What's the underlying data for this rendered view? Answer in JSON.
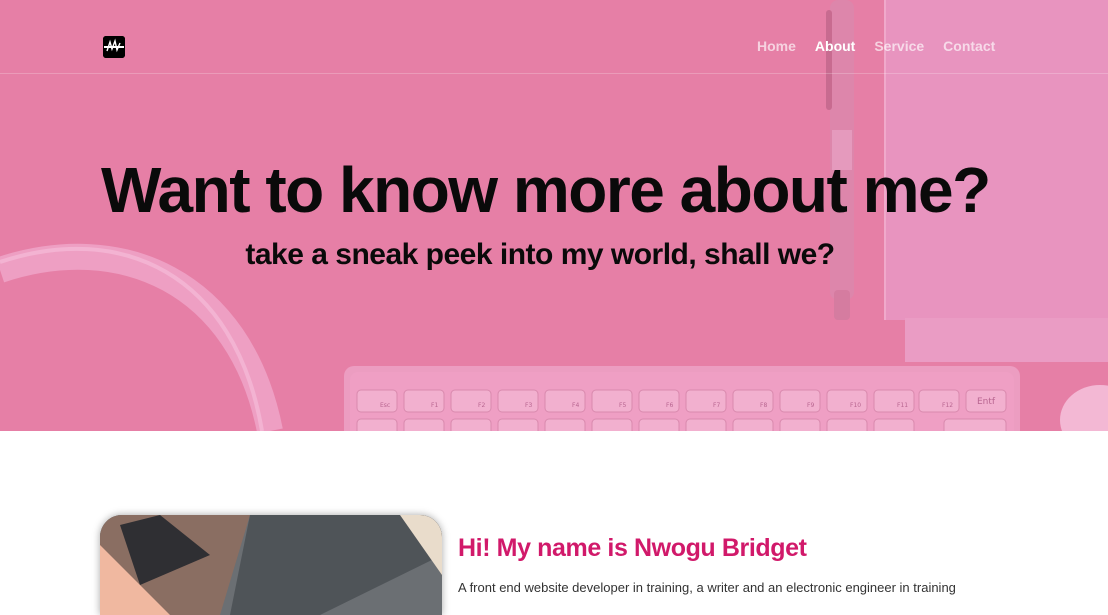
{
  "header": {
    "logo_icon": "nb-logo-icon",
    "nav": [
      {
        "label": "Home",
        "active": false
      },
      {
        "label": "About",
        "active": true
      },
      {
        "label": "Service",
        "active": false
      },
      {
        "label": "Contact",
        "active": false
      }
    ]
  },
  "hero": {
    "title": "Want to know more about me?",
    "subtitle": "take a sneak peek into my world, shall we?",
    "overlay_color": "#e67fa6",
    "keyboard_keys": [
      "Esc",
      "F1",
      "F2",
      "F3",
      "F4",
      "F5",
      "F6",
      "F7",
      "F8",
      "F9",
      "F10",
      "F11",
      "F12",
      "Entf"
    ]
  },
  "about": {
    "heading": "Hi! My name is Nwogu Bridget",
    "text": "A front end website developer in training, a writer and an electronic engineer in training",
    "accent_color": "#d1196a"
  }
}
